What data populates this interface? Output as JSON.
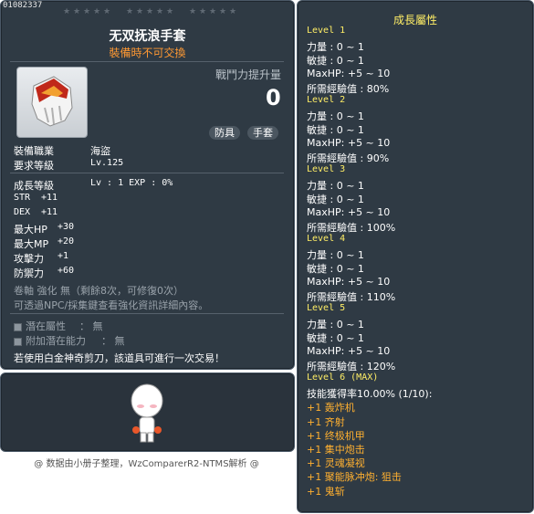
{
  "item": {
    "id": "01082337",
    "title": "无双抚浪手套",
    "trade_note": "裝備時不可交換",
    "power_label": "戰鬥力提升量",
    "power_value": "0",
    "tags": [
      "防具",
      "手套"
    ],
    "job_label": "裝備職業",
    "job_value": "海盜",
    "req_level_label": "要求等級",
    "req_level_value": "Lv.125",
    "growth_label": "成長等級",
    "growth_value": "Lv : 1  EXP : 0%",
    "stats": [
      {
        "name": "STR",
        "value": "+11"
      },
      {
        "name": "DEX",
        "value": "+11"
      },
      {
        "name": "最大HP",
        "value": "+30"
      },
      {
        "name": "最大MP",
        "value": "+20"
      },
      {
        "name": "攻擊力",
        "value": "+1"
      },
      {
        "name": "防禦力",
        "value": "+60"
      }
    ],
    "scroll_note": "卷軸 強化 無（剩餘8次，可修復0次）",
    "npc_note": "可透過NPC/採集鍵查看強化資訊詳細內容。",
    "potential_label": "潛在屬性",
    "potential_value": "： 無",
    "bonus_potential_label": "附加潛在能力",
    "bonus_potential_value": "： 無",
    "scissors_note": "若使用白金神奇剪刀，該道具可進行一次交易！"
  },
  "footer": "@ 数据由小册子整理，WzComparerR2-NTMS解析 @",
  "growth": {
    "title": "成長屬性",
    "levels": [
      {
        "label": "Level 1",
        "lines": [
          "力量 : 0 ~ 1",
          "敏捷 : 0 ~ 1",
          "MaxHP:  +5 ~ 10",
          "所需經驗值 : 80%"
        ]
      },
      {
        "label": "Level 2",
        "lines": [
          "力量 : 0 ~ 1",
          "敏捷 : 0 ~ 1",
          "MaxHP:  +5 ~ 10",
          "所需經驗值 : 90%"
        ]
      },
      {
        "label": "Level 3",
        "lines": [
          "力量 : 0 ~ 1",
          "敏捷 : 0 ~ 1",
          "MaxHP:  +5 ~ 10",
          "所需經驗值 : 100%"
        ]
      },
      {
        "label": "Level 4",
        "lines": [
          "力量 : 0 ~ 1",
          "敏捷 : 0 ~ 1",
          "MaxHP:  +5 ~ 10",
          "所需經驗值 : 110%"
        ]
      },
      {
        "label": "Level 5",
        "lines": [
          "力量 : 0 ~ 1",
          "敏捷 : 0 ~ 1",
          "MaxHP:  +5 ~ 10",
          "所需經驗值 : 120%"
        ]
      }
    ],
    "level6_label": "Level 6 (MAX)",
    "level6_rate": "技能獲得率10.00% (1/10):",
    "skills": [
      "+1 轰炸机",
      "+1 齐射",
      "+1 终极机甲",
      "+1 集中炮击",
      "+1 灵魂凝视",
      "+1 聚能脉冲炮: 狙击",
      "+1 鬼斩"
    ]
  },
  "colors": {
    "panel": "#2f3a44",
    "level_yellow": "#ffee66",
    "skill_orange": "#ffb030",
    "trade_orange": "#ff9933"
  }
}
